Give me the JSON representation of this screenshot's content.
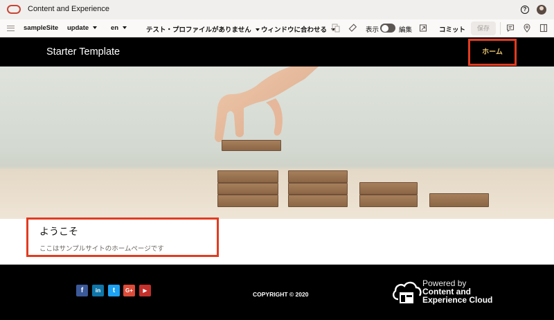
{
  "appbar": {
    "title": "Content and Experience",
    "icons": {
      "logo": "oracle-logo",
      "help": "help-icon",
      "user": "user-avatar"
    },
    "help_glyph": "?"
  },
  "toolbar": {
    "site": "sampleSite",
    "update": "update",
    "language": "en",
    "profile": "テスト・プロファイルがありません",
    "fit": "ウィンドウに合わせる",
    "view_label": "表示",
    "edit_label": "編集",
    "commit_label": "コミット",
    "save_label": "保存"
  },
  "site_header": {
    "title": "Starter Template",
    "nav_home": "ホーム"
  },
  "welcome": {
    "title": "ようこそ",
    "text": "ここはサンプルサイトのホームページです"
  },
  "footer": {
    "social": [
      {
        "name": "facebook",
        "glyph": "f",
        "color": "#3b5998"
      },
      {
        "name": "linkedin",
        "glyph": "in",
        "color": "#0e76a8"
      },
      {
        "name": "twitter",
        "glyph": "t",
        "color": "#1da1f2"
      },
      {
        "name": "google-plus",
        "glyph": "G+",
        "color": "#dd4b39"
      },
      {
        "name": "youtube",
        "glyph": "▶",
        "color": "#c4302b"
      }
    ],
    "copyright": "COPYRIGHT © 2020",
    "powered_line1": "Powered by",
    "powered_line2": "Content and",
    "powered_line3": "Experience Cloud"
  },
  "colors": {
    "highlight_border": "#e33b1f",
    "nav_text": "#e6c26b",
    "oracle_red": "#c74634"
  }
}
